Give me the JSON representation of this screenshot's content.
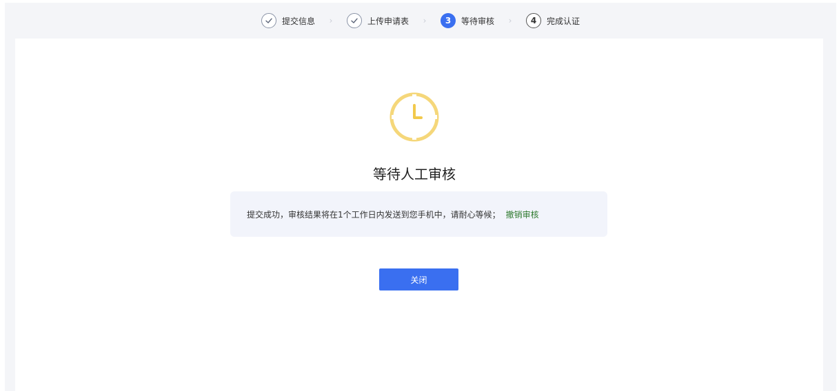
{
  "steps": [
    {
      "label": "提交信息",
      "state": "done",
      "icon": "check-icon"
    },
    {
      "label": "上传申请表",
      "state": "done",
      "icon": "check-icon"
    },
    {
      "number": "3",
      "label": "等待审核",
      "state": "active"
    },
    {
      "number": "4",
      "label": "完成认证",
      "state": "todo"
    }
  ],
  "status": {
    "icon": "clock-icon",
    "title": "等待人工审核",
    "message": "提交成功，审核结果将在1个工作日内发送到您手机中，请耐心等候；",
    "revoke_link": "撤销审核"
  },
  "actions": {
    "close_label": "关闭"
  },
  "colors": {
    "primary": "#3a6ff0",
    "clock": "#f5d77a",
    "link": "#2f7a2f",
    "notice_bg": "#f2f4fb"
  }
}
